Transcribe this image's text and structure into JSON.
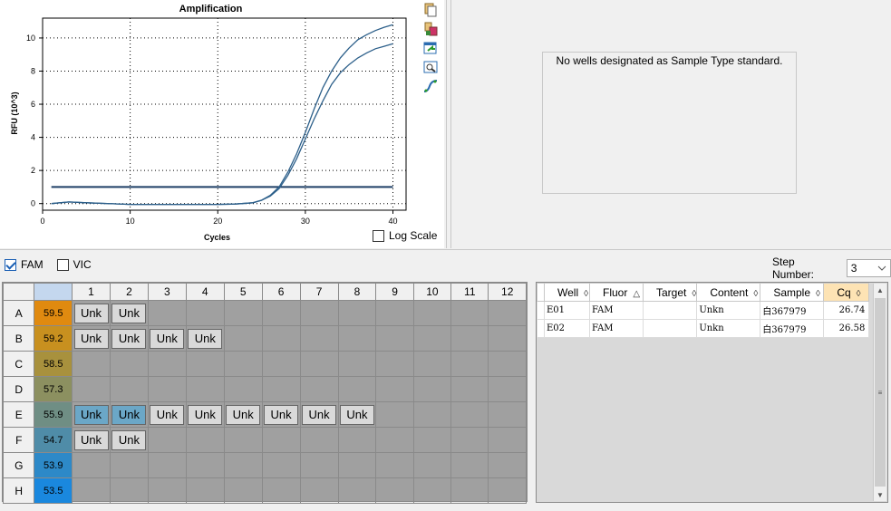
{
  "chart": {
    "title": "Amplification",
    "ylabel": "RFU (10^3)",
    "xlabel": "Cycles",
    "y_ticks": [
      "0",
      "2",
      "4",
      "6",
      "8",
      "10"
    ],
    "x_ticks": [
      "0",
      "10",
      "20",
      "30",
      "40"
    ],
    "log_scale_label": "Log Scale",
    "log_scale_checked": false
  },
  "chart_data": {
    "type": "line",
    "title": "Amplification",
    "xlabel": "Cycles",
    "ylabel": "RFU (10^3)",
    "xlim": [
      0,
      41.5
    ],
    "ylim": [
      -0.4,
      11.2
    ],
    "grid": true,
    "threshold": 1.0,
    "series": [
      {
        "x": [
          1,
          3,
          5,
          10,
          15,
          20,
          22,
          24,
          25,
          26,
          27,
          28,
          29,
          30,
          31,
          32,
          33,
          34,
          35,
          36,
          37,
          38,
          39,
          40
        ],
        "values": [
          0.0,
          0.1,
          0.05,
          -0.05,
          -0.05,
          -0.05,
          -0.03,
          0.05,
          0.2,
          0.5,
          1.0,
          1.9,
          3.0,
          4.3,
          5.7,
          7.0,
          8.0,
          8.8,
          9.4,
          9.9,
          10.2,
          10.45,
          10.65,
          10.8
        ]
      },
      {
        "x": [
          1,
          3,
          5,
          10,
          15,
          20,
          22,
          24,
          25,
          26,
          27,
          28,
          29,
          30,
          31,
          32,
          33,
          34,
          35,
          36,
          37,
          38,
          39,
          40
        ],
        "values": [
          0.0,
          0.1,
          0.05,
          -0.05,
          -0.05,
          -0.05,
          -0.03,
          0.05,
          0.2,
          0.45,
          0.9,
          1.7,
          2.7,
          3.9,
          5.1,
          6.2,
          7.2,
          7.9,
          8.4,
          8.8,
          9.1,
          9.35,
          9.5,
          9.65
        ]
      }
    ]
  },
  "standard_panel": {
    "message": "No wells designated as Sample Type standard."
  },
  "fluors": [
    {
      "label": "FAM",
      "checked": true
    },
    {
      "label": "VIC",
      "checked": false
    }
  ],
  "step": {
    "label": "Step Number:",
    "value": "3"
  },
  "plate": {
    "columns": [
      "1",
      "2",
      "3",
      "4",
      "5",
      "6",
      "7",
      "8",
      "9",
      "10",
      "11",
      "12"
    ],
    "rows": [
      {
        "label": "A",
        "temp": "59.5",
        "color": "#e08a10",
        "wells": [
          "Unk",
          "Unk",
          "",
          "",
          "",
          "",
          "",
          "",
          "",
          "",
          "",
          ""
        ],
        "selected": []
      },
      {
        "label": "B",
        "temp": "59.2",
        "color": "#c8901f",
        "wells": [
          "Unk",
          "Unk",
          "Unk",
          "Unk",
          "",
          "",
          "",
          "",
          "",
          "",
          "",
          ""
        ],
        "selected": []
      },
      {
        "label": "C",
        "temp": "58.5",
        "color": "#a8913d",
        "wells": [
          "",
          "",
          "",
          "",
          "",
          "",
          "",
          "",
          "",
          "",
          "",
          ""
        ],
        "selected": []
      },
      {
        "label": "D",
        "temp": "57.3",
        "color": "#8c9060",
        "wells": [
          "",
          "",
          "",
          "",
          "",
          "",
          "",
          "",
          "",
          "",
          "",
          ""
        ],
        "selected": []
      },
      {
        "label": "E",
        "temp": "55.9",
        "color": "#6f8e84",
        "wells": [
          "Unk",
          "Unk",
          "Unk",
          "Unk",
          "Unk",
          "Unk",
          "Unk",
          "Unk",
          "",
          "",
          "",
          ""
        ],
        "selected": [
          0,
          1
        ]
      },
      {
        "label": "F",
        "temp": "54.7",
        "color": "#4f8ca8",
        "wells": [
          "Unk",
          "Unk",
          "",
          "",
          "",
          "",
          "",
          "",
          "",
          "",
          "",
          ""
        ],
        "selected": []
      },
      {
        "label": "G",
        "temp": "53.9",
        "color": "#2d89c8",
        "wells": [
          "",
          "",
          "",
          "",
          "",
          "",
          "",
          "",
          "",
          "",
          "",
          ""
        ],
        "selected": []
      },
      {
        "label": "H",
        "temp": "53.5",
        "color": "#1a88de",
        "wells": [
          "",
          "",
          "",
          "",
          "",
          "",
          "",
          "",
          "",
          "",
          "",
          ""
        ],
        "selected": []
      }
    ]
  },
  "results": {
    "columns": [
      {
        "label": "Well",
        "sort": "◊"
      },
      {
        "label": "Fluor",
        "sort": "△"
      },
      {
        "label": "Target",
        "sort": "◊"
      },
      {
        "label": "Content",
        "sort": "◊"
      },
      {
        "label": "Sample",
        "sort": "◊"
      },
      {
        "label": "Cq",
        "sort": "◊"
      }
    ],
    "rows": [
      {
        "well": "E01",
        "fluor": "FAM",
        "target": "",
        "content": "Unkn",
        "sample": "白367979",
        "cq": "26.74"
      },
      {
        "well": "E02",
        "fluor": "FAM",
        "target": "",
        "content": "Unkn",
        "sample": "白367979",
        "cq": "26.58"
      }
    ]
  },
  "icons": [
    "copy-icon",
    "print-icon",
    "export-icon",
    "zoom-icon",
    "graph-options-icon",
    "scroll-up-icon",
    "scroll-down-icon",
    "scroll-grip-icon",
    "dropdown-chevron-icon"
  ]
}
